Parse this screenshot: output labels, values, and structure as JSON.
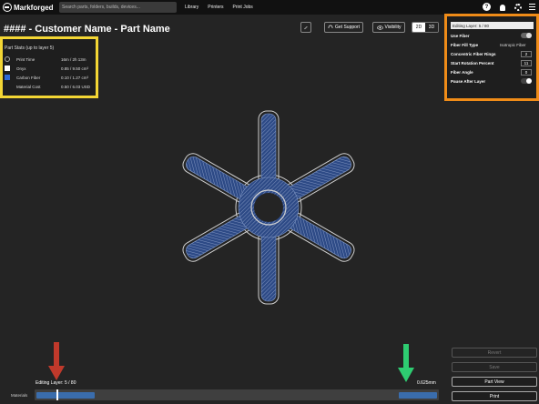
{
  "brand": {
    "name": "Markforged"
  },
  "search": {
    "placeholder": "Search parts, folders, builds, devices..."
  },
  "nav": {
    "items": [
      "Library",
      "Printers",
      "Print Jobs"
    ]
  },
  "top_icons": [
    "help-icon",
    "bell-icon",
    "gear-icon",
    "menu-icon"
  ],
  "header": {
    "title": "#### - Customer Name - Part Name",
    "support_label": "Get Support",
    "visibility_label": "Visibility",
    "view_2d": "2D",
    "view_3d": "3D",
    "active_view": "2D"
  },
  "part_stats": {
    "heading": "Part Stats (up to layer 5)",
    "rows": [
      {
        "label": "Print Time",
        "value": "16m / 2h 13m",
        "swatch": "clock-icon"
      },
      {
        "label": "Onyx",
        "value": "0.85 / 9.50 cm³",
        "swatch": "#ffffff"
      },
      {
        "label": "Carbon Fiber",
        "value": "0.10 / 1.27 cm³",
        "swatch": "#2f6ad8"
      },
      {
        "label": "Material Cost",
        "value": "0.50 / 6.03 USD",
        "swatch": ""
      }
    ]
  },
  "fiber_panel": {
    "editing_layer": "Editing Layer: 5 / 80",
    "use_fiber_label": "Use Fiber",
    "use_fiber_on": true,
    "fill_type_label": "Fiber Fill Type",
    "fill_type_value": "Isotropic Fiber",
    "rings_label": "Concentric Fiber Rings",
    "rings_value": "2",
    "rotation_label": "Start Rotation Percent",
    "rotation_value": "11",
    "angle_label": "Fiber Angle",
    "angle_value": "0",
    "pause_label": "Pause After Layer",
    "pause_on": false
  },
  "actions": {
    "revert": "Revert",
    "save": "Save",
    "part_view": "Part View",
    "print": "Print"
  },
  "layer_slider": {
    "editing_label": "Editing Layer: 5 / 80",
    "height_label": "0.625mm",
    "materials_label": "Materials",
    "current_layer": 5,
    "total_layers": 80
  },
  "colors": {
    "accent_yellow": "#f3d634",
    "accent_orange": "#f08c18",
    "fiber_blue": "#3a6dad",
    "arrow_red": "#c0392b",
    "arrow_green": "#2ecc71"
  }
}
